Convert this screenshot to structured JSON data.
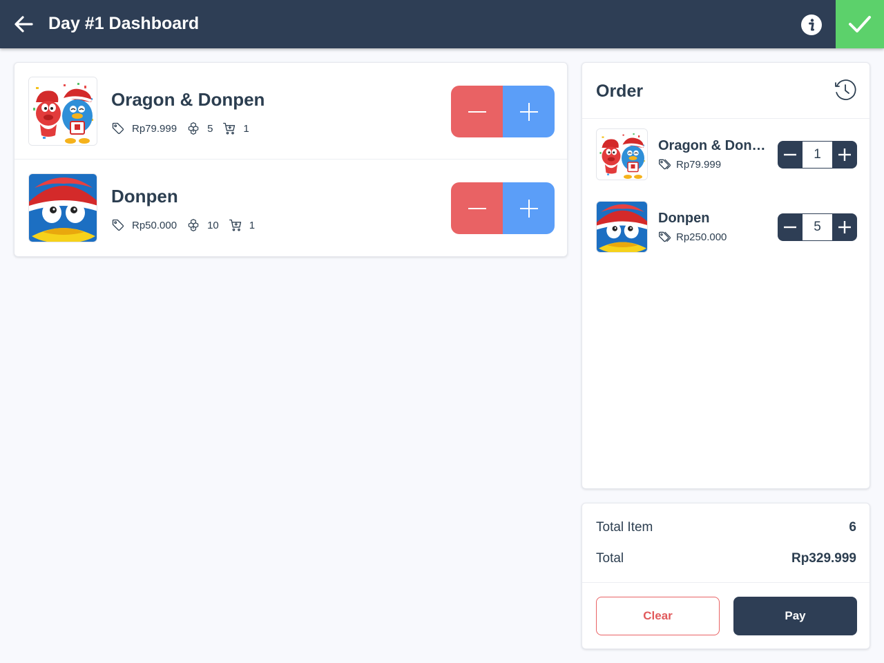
{
  "header": {
    "title": "Day #1 Dashboard",
    "back_icon": "arrow-left-icon",
    "info_icon": "info-icon",
    "confirm_icon": "check-icon",
    "bar_color": "#2e3e55",
    "confirm_color": "#5cd16b"
  },
  "products": [
    {
      "name": "Oragon & Donpen",
      "price": "Rp79.999",
      "stock": "5",
      "cart": "1",
      "image": "oragon-donpen-image"
    },
    {
      "name": "Donpen",
      "price": "Rp50.000",
      "stock": "10",
      "cart": "1",
      "image": "donpen-image"
    }
  ],
  "product_meta_icons": {
    "price": "tag-icon",
    "stock": "boxes-icon",
    "cart": "cart-icon"
  },
  "stepper_colors": {
    "minus": "#e96264",
    "plus": "#5b9ef8"
  },
  "order": {
    "title": "Order",
    "history_icon": "clock-icon",
    "items": [
      {
        "name": "Oragon & Donpen",
        "price": "Rp79.999",
        "qty": "1"
      },
      {
        "name": "Donpen",
        "price": "Rp250.000",
        "qty": "5"
      }
    ]
  },
  "summary": {
    "total_item_label": "Total Item",
    "total_item_value": "6",
    "total_label": "Total",
    "total_value": "Rp329.999",
    "clear_label": "Clear",
    "pay_label": "Pay"
  }
}
